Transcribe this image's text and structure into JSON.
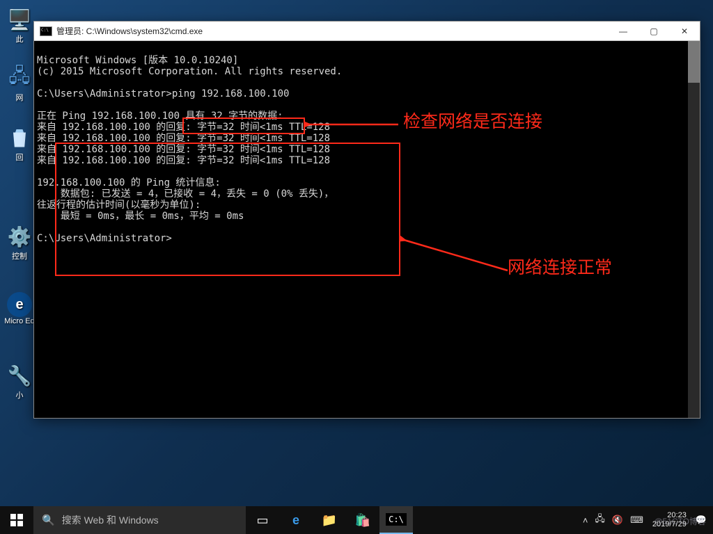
{
  "desktop": {
    "computer_label": "此",
    "network_label": "网",
    "recycle_label": "回",
    "control_label": "控制",
    "edge_label": "Micro Ed",
    "tool_label": "小"
  },
  "window": {
    "title": "管理员: C:\\Windows\\system32\\cmd.exe"
  },
  "terminal": {
    "line_version": "Microsoft Windows [版本 10.0.10240]",
    "line_copyright": "(c) 2015 Microsoft Corporation. All rights reserved.",
    "prompt1": "C:\\Users\\Administrator>ping 192.168.100.100",
    "out1": "正在 Ping 192.168.100.100 具有 32 字节的数据:",
    "out2": "来自 192.168.100.100 的回复: 字节=32 时间<1ms TTL=128",
    "out3": "来自 192.168.100.100 的回复: 字节=32 时间<1ms TTL=128",
    "out4": "来自 192.168.100.100 的回复: 字节=32 时间<1ms TTL=128",
    "out5": "来自 192.168.100.100 的回复: 字节=32 时间<1ms TTL=128",
    "stat_title": "192.168.100.100 的 Ping 统计信息:",
    "stat_packets": "    数据包: 已发送 = 4，已接收 = 4，丢失 = 0 (0% 丢失)，",
    "stat_roundtrip_title": "往返行程的估计时间(以毫秒为单位):",
    "stat_roundtrip": "    最短 = 0ms，最长 = 0ms，平均 = 0ms",
    "prompt2": "C:\\Users\\Administrator>"
  },
  "annotations": {
    "note1": "检查网络是否连接",
    "note2": "网络连接正常"
  },
  "taskbar": {
    "search_placeholder": "搜索 Web 和 Windows",
    "clock_time": "20:23",
    "clock_date": "2019/7/29"
  },
  "watermark": "@51CTO博客"
}
